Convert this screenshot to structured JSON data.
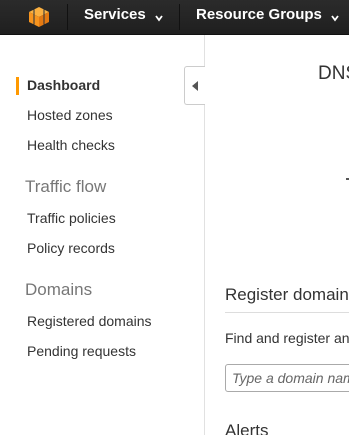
{
  "topbar": {
    "services_label": "Services",
    "resource_groups_label": "Resource Groups",
    "logo_icon": "aws-cube-icon",
    "brand_color": "#f90"
  },
  "sidebar": {
    "items": [
      {
        "label": "Dashboard",
        "active": true
      },
      {
        "label": "Hosted zones"
      },
      {
        "label": "Health checks"
      }
    ],
    "traffic_flow": {
      "header": "Traffic flow",
      "items": [
        {
          "label": "Traffic policies"
        },
        {
          "label": "Policy records"
        }
      ]
    },
    "domains": {
      "header": "Domains",
      "items": [
        {
          "label": "Registered domains"
        },
        {
          "label": "Pending requests"
        }
      ]
    },
    "collapse_icon": "collapse-left-icon"
  },
  "main": {
    "title": "DNS",
    "register": {
      "title": "Register domain",
      "description": "Find and register an",
      "input_placeholder": "Type a domain name"
    },
    "alerts_title": "Alerts"
  }
}
